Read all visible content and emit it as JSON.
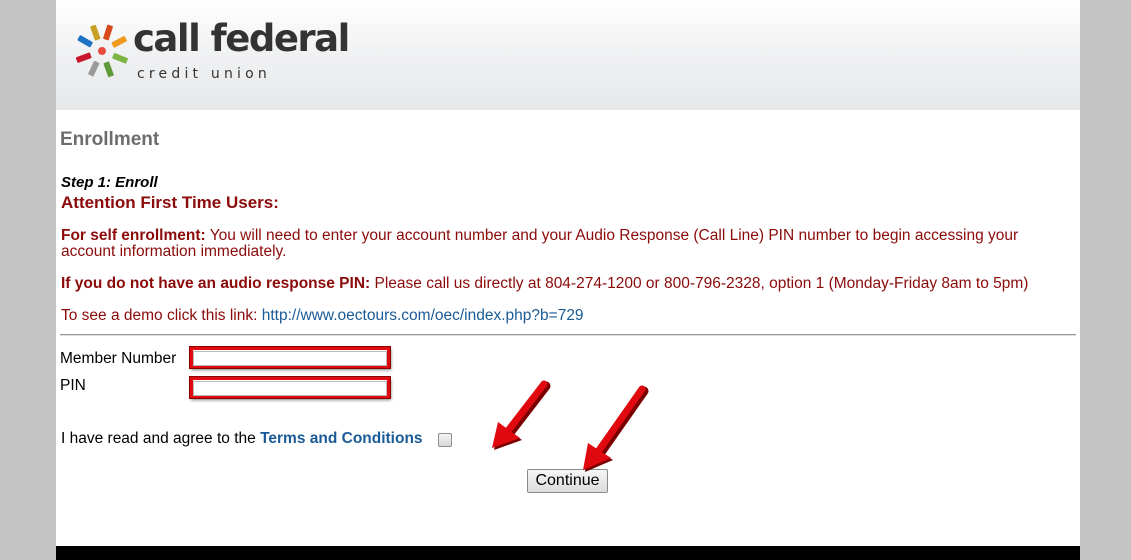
{
  "logo": {
    "name": "call federal",
    "tagline": "credit union"
  },
  "page": {
    "title": "Enrollment",
    "step": "Step 1: Enroll",
    "attention": "Attention First Time Users:"
  },
  "info": {
    "self_enroll_label": "For self enrollment:",
    "self_enroll_text": " You will need to enter your account number and your Audio Response (Call Line) PIN number to begin accessing your account information immediately.",
    "no_pin_label": "If you do not have an audio response PIN:",
    "no_pin_text": " Please call us directly at 804-274-1200 or 800-796-2328, option 1 (Monday-Friday 8am to 5pm)",
    "demo_text": "To see a demo click this link: ",
    "demo_link": "http://www.oectours.com/oec/index.php?b=729"
  },
  "form": {
    "member_label": "Member Number",
    "member_value": "",
    "pin_label": "PIN",
    "pin_value": "",
    "agree_text": "I have read and agree to the ",
    "terms_link": "Terms and Conditions",
    "terms_checked": false,
    "continue_label": "Continue"
  },
  "colors": {
    "heading": "#8b0a0a",
    "link": "#1a5b97",
    "highlight": "#e0090f",
    "background": "#c4c4c4"
  },
  "annotations": {
    "arrow_count": 2,
    "arrow_color": "#e0090f"
  }
}
